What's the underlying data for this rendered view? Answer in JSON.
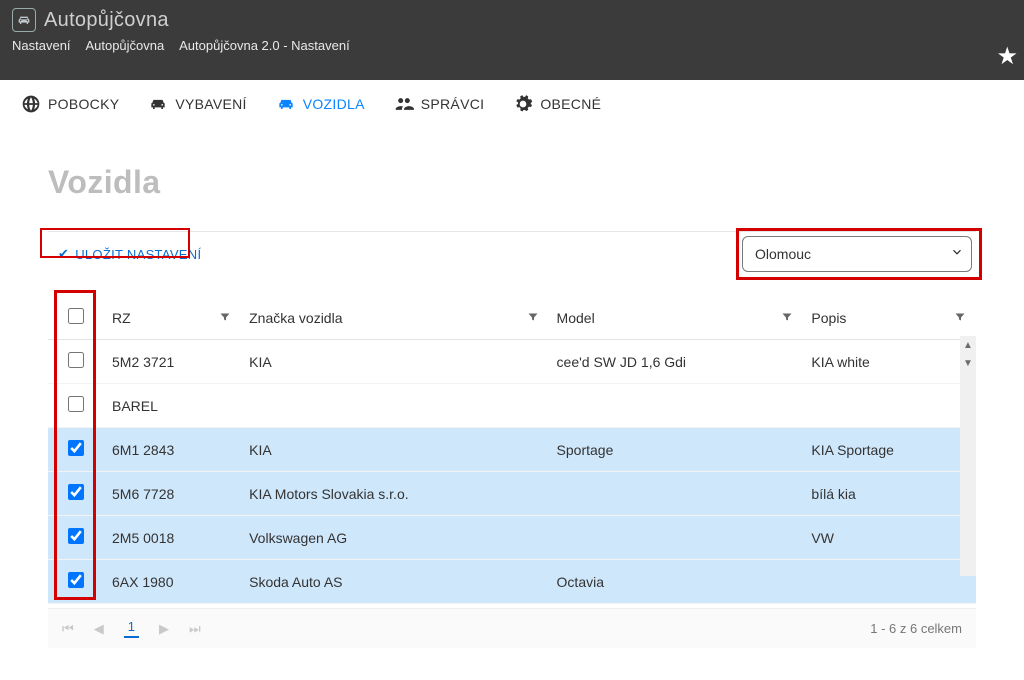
{
  "app": {
    "title": "Autopůjčovna"
  },
  "breadcrumbs": [
    "Nastavení",
    "Autopůjčovna",
    "Autopůjčovna 2.0 - Nastavení"
  ],
  "tabs": [
    {
      "id": "pobocky",
      "label": "POBOCKY",
      "active": false
    },
    {
      "id": "vybaveni",
      "label": "VYBAVENÍ",
      "active": false
    },
    {
      "id": "vozidla",
      "label": "VOZIDLA",
      "active": true
    },
    {
      "id": "spravci",
      "label": "SPRÁVCI",
      "active": false
    },
    {
      "id": "obecne",
      "label": "OBECNÉ",
      "active": false
    }
  ],
  "page": {
    "title": "Vozidla"
  },
  "toolbar": {
    "save_label": "ULOŽIT NASTAVENÍ"
  },
  "branch": {
    "selected": "Olomouc"
  },
  "grid": {
    "columns": [
      "RZ",
      "Značka vozidla",
      "Model",
      "Popis"
    ],
    "rows": [
      {
        "checked": false,
        "rz": "5M2 3721",
        "brand": "KIA",
        "model": "cee'd SW JD 1,6 Gdi",
        "desc": "KIA white"
      },
      {
        "checked": false,
        "rz": "BAREL",
        "brand": "",
        "model": "",
        "desc": ""
      },
      {
        "checked": true,
        "rz": "6M1 2843",
        "brand": "KIA",
        "model": "Sportage",
        "desc": "KIA Sportage"
      },
      {
        "checked": true,
        "rz": "5M6 7728",
        "brand": "KIA Motors Slovakia s.r.o.",
        "model": "",
        "desc": "bílá kia"
      },
      {
        "checked": true,
        "rz": "2M5 0018",
        "brand": "Volkswagen AG",
        "model": "",
        "desc": "VW"
      },
      {
        "checked": true,
        "rz": "6AX 1980",
        "brand": "Skoda Auto AS",
        "model": "Octavia",
        "desc": ""
      }
    ]
  },
  "pager": {
    "current_page": "1",
    "summary": "1 - 6 z 6 celkem"
  }
}
